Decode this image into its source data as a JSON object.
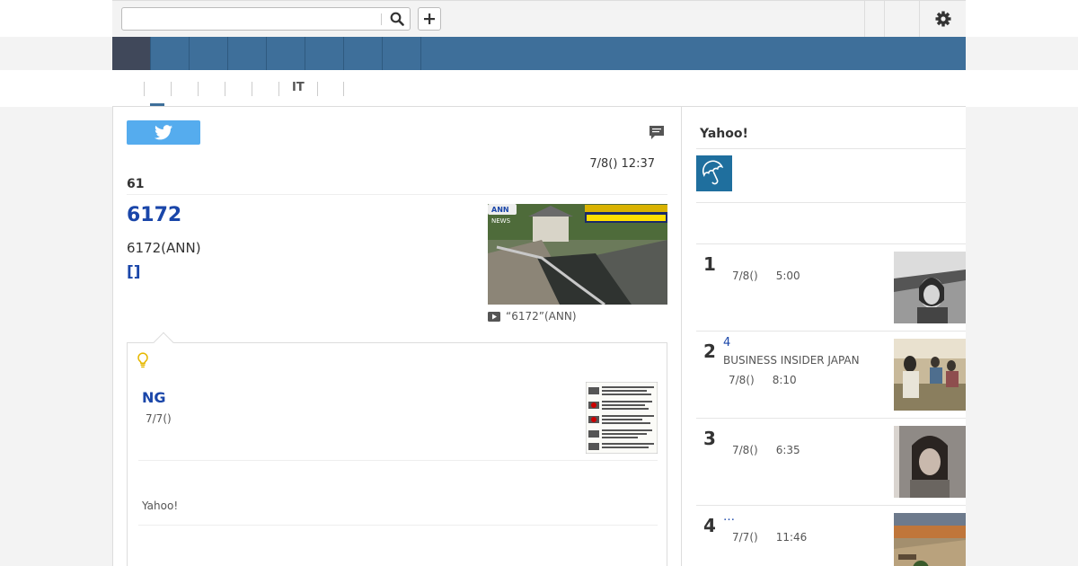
{
  "search": {
    "value": "",
    "placeholder": ""
  },
  "nav": {
    "items": [
      "",
      "",
      "",
      "",
      "",
      "",
      "",
      "",
      ""
    ]
  },
  "subnav": {
    "items": [
      "",
      "",
      "",
      "",
      "",
      "IT",
      "",
      ""
    ]
  },
  "article": {
    "date": "7/8() 12:37",
    "count": "61",
    "headline": "6172",
    "subtitle": "6172(ANN)",
    "bracket_link": "[]",
    "thumb_caption": "“6172”(ANN)",
    "thumb_tv_logo": "ANN",
    "thumb_tv_sub": "NEWS"
  },
  "tip": {
    "title": "NG",
    "date": "7/7()",
    "source": "Yahoo!"
  },
  "sidebar": {
    "title": "Yahoo!",
    "ranking": [
      {
        "num": "1",
        "link": "",
        "source": "",
        "date": "7/8()",
        "time": "5:00"
      },
      {
        "num": "2",
        "link": "4",
        "source": "BUSINESS INSIDER JAPAN",
        "date": "7/8()",
        "time": "8:10"
      },
      {
        "num": "3",
        "link": "",
        "source": "",
        "date": "7/8()",
        "time": "6:35"
      },
      {
        "num": "4",
        "link": "…",
        "source": "",
        "date": "7/7()",
        "time": "11:46"
      }
    ]
  },
  "colors": {
    "nav": "#3e6f9a",
    "nav_active": "#40485a",
    "link": "#1a46a9",
    "tweet": "#55acee"
  },
  "icons": [
    "search-icon",
    "plus-icon",
    "gear-icon",
    "twitter-icon",
    "comment-icon",
    "bulb-icon",
    "play-icon",
    "umbrella-icon"
  ]
}
